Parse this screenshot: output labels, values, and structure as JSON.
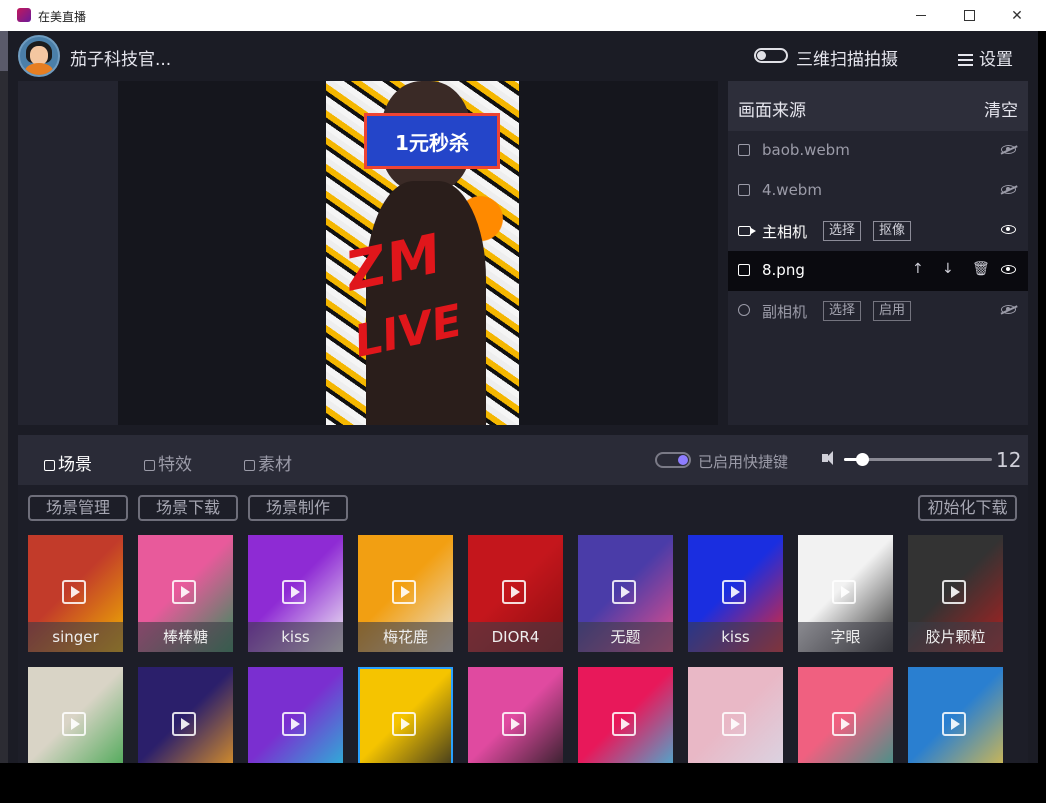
{
  "window": {
    "title": "在美直播"
  },
  "header": {
    "username": "茄子科技官...",
    "scan_label": "三维扫描拍摄",
    "settings_label": "设置"
  },
  "sources": {
    "title": "画面来源",
    "clear": "清空",
    "rows": [
      {
        "name": "baob.webm",
        "icon": "image-icon",
        "visible": false
      },
      {
        "name": "4.webm",
        "icon": "image-icon",
        "visible": false
      },
      {
        "name": "主相机",
        "icon": "camera-icon",
        "tag1": "选择",
        "tag2": "抠像",
        "visible": true
      },
      {
        "name": "8.png",
        "icon": "image-icon",
        "visible": true,
        "selected": true
      },
      {
        "name": "副相机",
        "icon": "webcam-icon",
        "tag1": "选择",
        "tag2": "启用",
        "visible": false
      }
    ]
  },
  "preview": {
    "banner": "1元秒杀",
    "logo_line1": "ZM",
    "logo_line2": "LIVE"
  },
  "tabs": [
    {
      "label": "场景",
      "active": true
    },
    {
      "label": "特效"
    },
    {
      "label": "素材"
    }
  ],
  "hotkey_label": "已启用快捷键",
  "volume": {
    "value": "12",
    "level": 0.12
  },
  "buttons": {
    "manage": "场景管理",
    "download": "场景下载",
    "make": "场景制作",
    "init_download": "初始化下载"
  },
  "scenes_row1": [
    {
      "label": "singer",
      "c1": "#c23b2a",
      "c2": "#f0b400"
    },
    {
      "label": "棒棒糖",
      "c1": "#e85a9b",
      "c2": "#2f8f5a"
    },
    {
      "label": "kiss",
      "c1": "#8e2bd4",
      "c2": "#f4f4f4"
    },
    {
      "label": "梅花鹿",
      "c1": "#f29f12",
      "c2": "#e8e0d0"
    },
    {
      "label": "DIOR4",
      "c1": "#c4161c",
      "c2": "#8a0d10"
    },
    {
      "label": "无题",
      "c1": "#4a3ca8",
      "c2": "#e94f8a"
    },
    {
      "label": "kiss",
      "c1": "#1a2ee0",
      "c2": "#e6282f"
    },
    {
      "label": "字眼",
      "c1": "#f2f2f2",
      "c2": "#2b2b2b"
    },
    {
      "label": "胶片颗粒",
      "c1": "#333333",
      "c2": "#b02020"
    }
  ],
  "scenes_row2": [
    {
      "c1": "#d9d4c6",
      "c2": "#3aa348"
    },
    {
      "c1": "#2b1f6b",
      "c2": "#f0a020"
    },
    {
      "c1": "#7a2fd0",
      "c2": "#22c4d8"
    },
    {
      "c1": "#f5c400",
      "c2": "#222222",
      "selected": true
    },
    {
      "c1": "#e04aa0",
      "c2": "#1a1a1a"
    },
    {
      "c1": "#e8185a",
      "c2": "#35c0e0"
    },
    {
      "c1": "#e9b8c6",
      "c2": "#d8d8e6"
    },
    {
      "c1": "#f06080",
      "c2": "#2a9a8a"
    },
    {
      "c1": "#2a7fd0",
      "c2": "#e8c040"
    }
  ]
}
